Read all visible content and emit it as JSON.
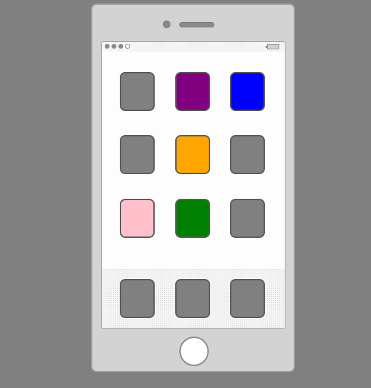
{
  "device": {
    "frame_color": "#d3d3d3",
    "background_color": "#808080"
  },
  "status_bar": {
    "signal_bars_filled": 3,
    "signal_bars_total": 4,
    "battery_icon": "battery-icon"
  },
  "home_screen": {
    "apps": [
      {
        "id": "app-1",
        "color": "#808080"
      },
      {
        "id": "app-2",
        "color": "#800080"
      },
      {
        "id": "app-3",
        "color": "#0000ff"
      },
      {
        "id": "app-4",
        "color": "#808080"
      },
      {
        "id": "app-5",
        "color": "#ffa500"
      },
      {
        "id": "app-6",
        "color": "#808080"
      },
      {
        "id": "app-7",
        "color": "#ffc0cb"
      },
      {
        "id": "app-8",
        "color": "#008000"
      },
      {
        "id": "app-9",
        "color": "#808080"
      }
    ]
  },
  "dock": {
    "apps": [
      {
        "id": "dock-app-1",
        "color": "#808080"
      },
      {
        "id": "dock-app-2",
        "color": "#808080"
      },
      {
        "id": "dock-app-3",
        "color": "#808080"
      }
    ]
  }
}
